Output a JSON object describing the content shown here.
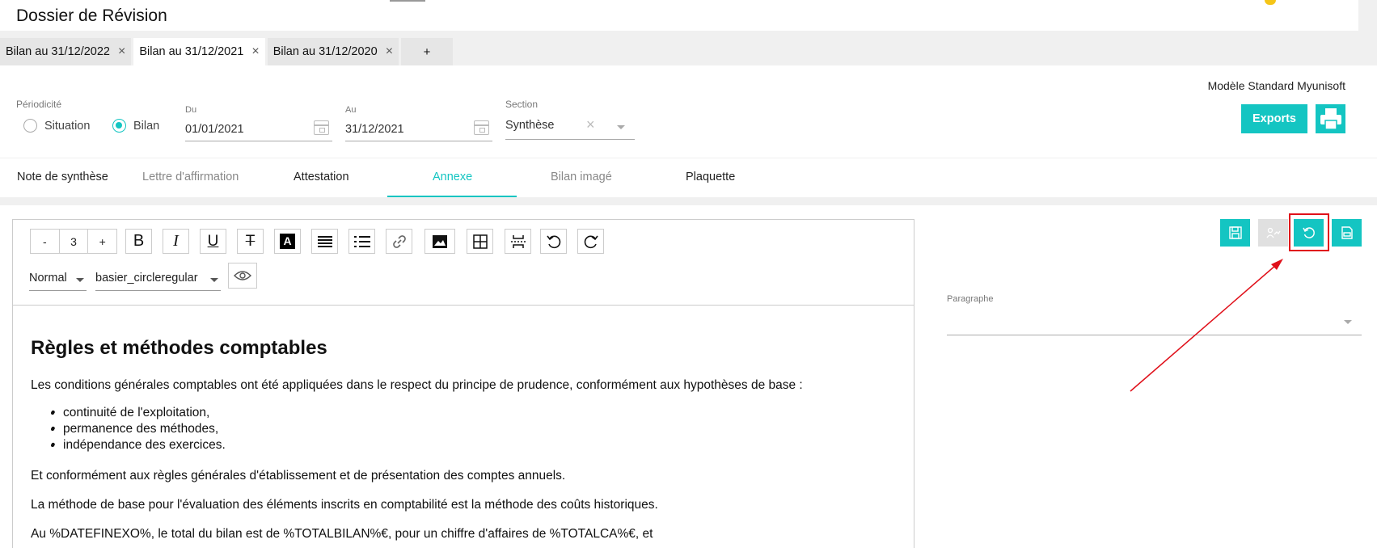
{
  "header": {
    "title": "Dossier de Révision"
  },
  "tabs": [
    {
      "label": "Bilan au 31/12/2022",
      "close": "×"
    },
    {
      "label": "Bilan au 31/12/2021",
      "close": "×"
    },
    {
      "label": "Bilan au 31/12/2020",
      "close": "×"
    },
    {
      "label": "+"
    }
  ],
  "filters": {
    "periodicity_label": "Périodicité",
    "radio_situation": "Situation",
    "radio_bilan": "Bilan",
    "selected_radio": "Bilan",
    "from_label": "Du",
    "from_value": "01/01/2021",
    "to_label": "Au",
    "to_value": "31/12/2021",
    "section_label": "Section",
    "section_value": "Synthèse",
    "section_clear": "×",
    "model": "Modèle Standard Myunisoft",
    "exports_label": "Exports"
  },
  "nav": [
    {
      "label": "Note de synthèse",
      "state": "normal"
    },
    {
      "label": "Lettre d'affirmation",
      "state": "dim"
    },
    {
      "label": "Attestation",
      "state": "normal"
    },
    {
      "label": "Annexe",
      "state": "active"
    },
    {
      "label": "Bilan imagé",
      "state": "dim"
    },
    {
      "label": "Plaquette",
      "state": "normal"
    }
  ],
  "toolbar": {
    "minus": "-",
    "size": "3",
    "plus": "+",
    "bold": "B",
    "italic": "I",
    "underline": "U",
    "strike": "T",
    "color": "A",
    "style_value": "Normal",
    "font_value": "basier_circleregular"
  },
  "document": {
    "heading": "Règles et méthodes comptables",
    "intro": "Les conditions générales comptables ont été appliquées dans le respect du principe de prudence, conformément aux hypothèses de base :",
    "bullets": [
      "continuité de l'exploitation,",
      "permanence des méthodes,",
      "indépendance des exercices."
    ],
    "p2": "Et conformément aux règles générales d'établissement et de présentation des comptes annuels.",
    "p3": "La méthode de base pour l'évaluation des éléments inscrits en comptabilité est la méthode des coûts historiques.",
    "p4": "Au %DATEFINEXO%, le total du bilan est de %TOTALBILAN%€, pour un chiffre d'affaires de %TOTALCA%€, et"
  },
  "side": {
    "paragraph_label": "Paragraphe"
  },
  "colors": {
    "accent": "#14c5c2",
    "highlight": "#e0101a"
  }
}
